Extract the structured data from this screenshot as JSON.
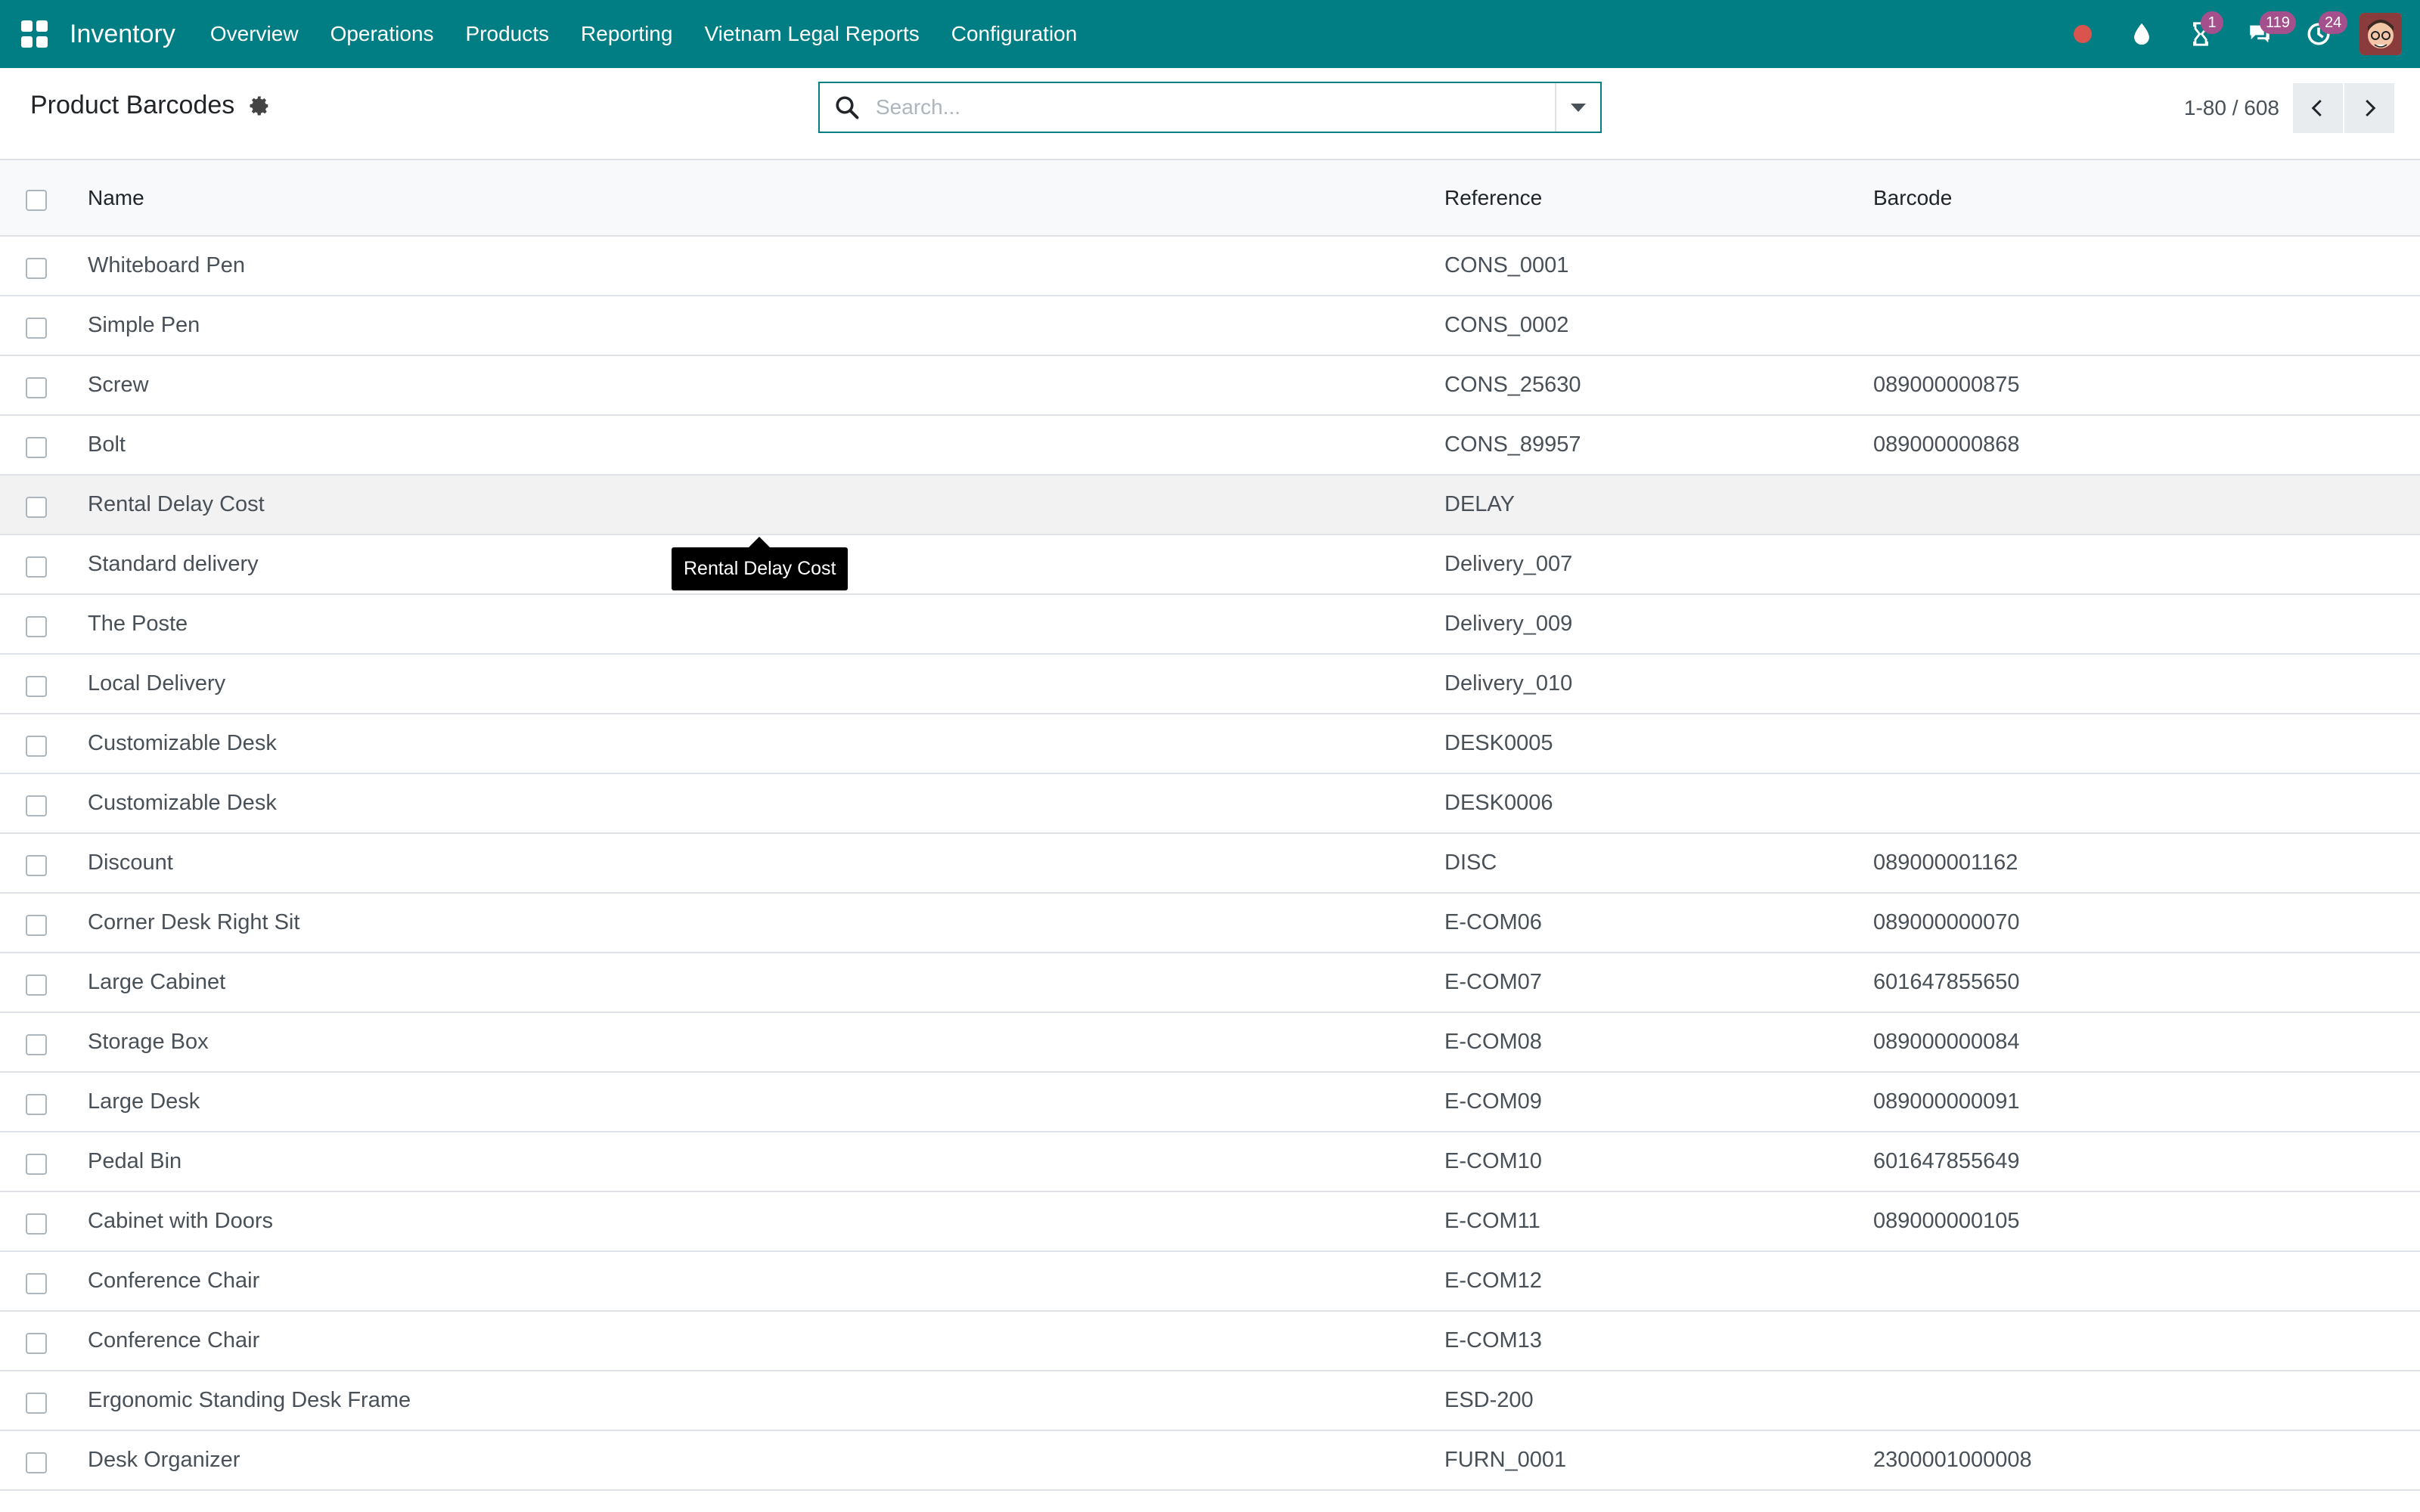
{
  "navbar": {
    "app_name": "Inventory",
    "menu": [
      "Overview",
      "Operations",
      "Products",
      "Reporting",
      "Vietnam Legal Reports",
      "Configuration"
    ],
    "icons": [
      "apps-grid-icon",
      "record-dot-icon",
      "drop-icon",
      "hourglass-icon",
      "chat-icon",
      "clock-icon",
      "avatar"
    ],
    "badges": {
      "activities": "1",
      "messages": "119",
      "timesheets": "24"
    },
    "colors": {
      "navbar_bg": "#017e84",
      "badge_bg": "#a3508d",
      "record_dot": "#d9534f"
    }
  },
  "control_panel": {
    "title": "Product Barcodes",
    "search_placeholder": "Search...",
    "pager_value": "1-80 / 608"
  },
  "table": {
    "columns": [
      "Name",
      "Reference",
      "Barcode"
    ],
    "rows": [
      {
        "name": "Whiteboard Pen",
        "reference": "CONS_0001",
        "barcode": ""
      },
      {
        "name": "Simple Pen",
        "reference": "CONS_0002",
        "barcode": ""
      },
      {
        "name": "Screw",
        "reference": "CONS_25630",
        "barcode": "089000000875"
      },
      {
        "name": "Bolt",
        "reference": "CONS_89957",
        "barcode": "089000000868"
      },
      {
        "name": "Rental Delay Cost",
        "reference": "DELAY",
        "barcode": ""
      },
      {
        "name": "Standard delivery",
        "reference": "Delivery_007",
        "barcode": ""
      },
      {
        "name": "The Poste",
        "reference": "Delivery_009",
        "barcode": ""
      },
      {
        "name": "Local Delivery",
        "reference": "Delivery_010",
        "barcode": ""
      },
      {
        "name": "Customizable Desk",
        "reference": "DESK0005",
        "barcode": ""
      },
      {
        "name": "Customizable Desk",
        "reference": "DESK0006",
        "barcode": ""
      },
      {
        "name": "Discount",
        "reference": "DISC",
        "barcode": "089000001162"
      },
      {
        "name": "Corner Desk Right Sit",
        "reference": "E-COM06",
        "barcode": "089000000070"
      },
      {
        "name": "Large Cabinet",
        "reference": "E-COM07",
        "barcode": "601647855650"
      },
      {
        "name": "Storage Box",
        "reference": "E-COM08",
        "barcode": "089000000084"
      },
      {
        "name": "Large Desk",
        "reference": "E-COM09",
        "barcode": "089000000091"
      },
      {
        "name": "Pedal Bin",
        "reference": "E-COM10",
        "barcode": "601647855649"
      },
      {
        "name": "Cabinet with Doors",
        "reference": "E-COM11",
        "barcode": "089000000105"
      },
      {
        "name": "Conference Chair",
        "reference": "E-COM12",
        "barcode": ""
      },
      {
        "name": "Conference Chair",
        "reference": "E-COM13",
        "barcode": ""
      },
      {
        "name": "Ergonomic Standing Desk Frame",
        "reference": "ESD-200",
        "barcode": ""
      },
      {
        "name": "Desk Organizer",
        "reference": "FURN_0001",
        "barcode": "2300001000008"
      }
    ]
  },
  "tooltip": {
    "text": "Rental Delay Cost"
  }
}
